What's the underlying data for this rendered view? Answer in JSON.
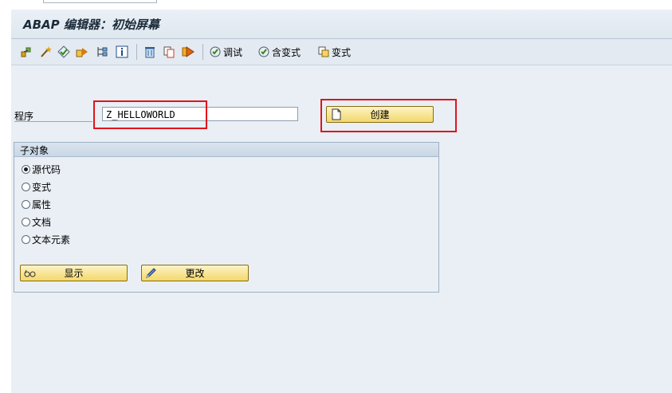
{
  "window": {
    "title": "ABAP 编辑器：初始屏幕"
  },
  "toolbar": {
    "icons": [
      "object-list-icon",
      "wand-icon",
      "check-icon",
      "activate-icon",
      "where-used-icon",
      "info-icon",
      "delete-icon",
      "copy-icon",
      "execute-icon"
    ],
    "debug_label": "调试",
    "with_variant_label": "含变式",
    "variant_label": "变式"
  },
  "program": {
    "label": "程序",
    "value": "Z_HELLOWORLD",
    "create_label": "创建"
  },
  "subobjects": {
    "title": "子对象",
    "options": [
      {
        "label": "源代码",
        "selected": true
      },
      {
        "label": "变式",
        "selected": false
      },
      {
        "label": "属性",
        "selected": false
      },
      {
        "label": "文档",
        "selected": false
      },
      {
        "label": "文本元素",
        "selected": false
      }
    ],
    "display_label": "显示",
    "change_label": "更改"
  },
  "colors": {
    "highlight": "#e0141b",
    "button_gold": "#f3d86b",
    "background": "#e9eff5"
  }
}
